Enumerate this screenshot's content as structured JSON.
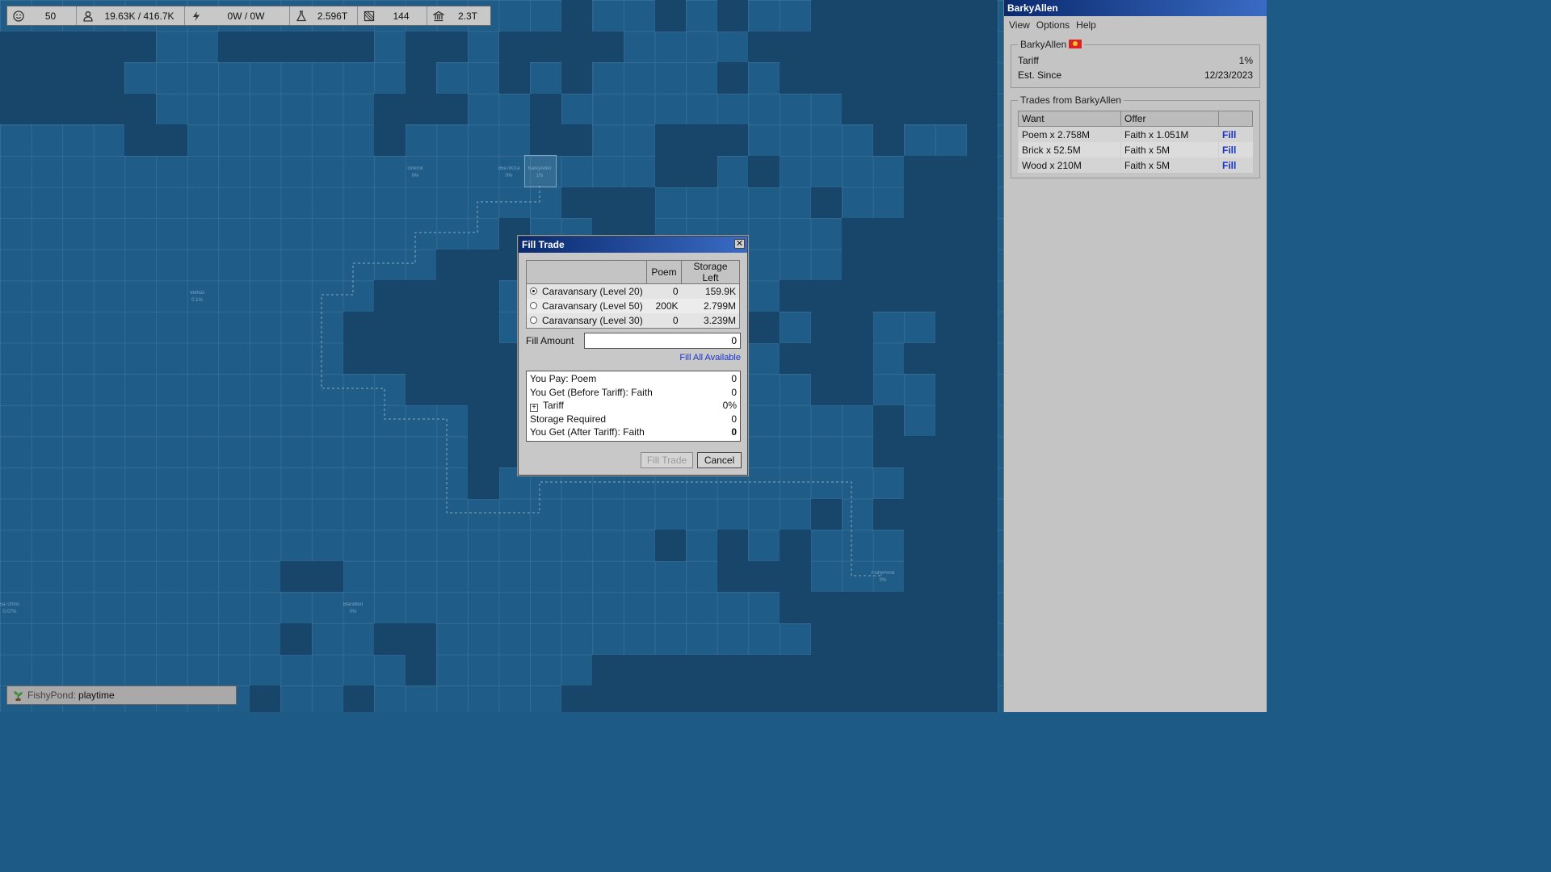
{
  "status_bar": {
    "happiness": "50",
    "population": "19.63K / 416.7K",
    "power": "0W / 0W",
    "research": "2.596T",
    "land": "144",
    "treasury": "2.3T"
  },
  "map": {
    "city_labels": [
      {
        "name": "Gnkrnk",
        "tariff": "0%"
      },
      {
        "name": "d5e7801a",
        "tariff": "0%"
      },
      {
        "name": "BarkyAllen",
        "tariff": "1%"
      },
      {
        "name": "Vethos",
        "tariff": "0.1%"
      },
      {
        "name": "FishyPond",
        "tariff": "0%"
      },
      {
        "name": "5a72f00c",
        "tariff": "0.07%"
      },
      {
        "name": "BlandBot",
        "tariff": "0%"
      }
    ]
  },
  "bottom_bar": {
    "user": "FishyPond",
    "separator": ":",
    "message": "playtime"
  },
  "panel": {
    "title": "BarkyAllen",
    "menu": [
      "View",
      "Options",
      "Help"
    ],
    "city_name": "BarkyAllen",
    "tariff_label": "Tariff",
    "tariff_value": "1%",
    "est_label": "Est. Since",
    "est_value": "12/23/2023",
    "trades_title": "Trades from BarkyAllen",
    "trades_headers": [
      "Want",
      "Offer",
      ""
    ],
    "trades": [
      {
        "want": "Poem x 2.758M",
        "offer": "Faith x 1.051M",
        "action": "Fill"
      },
      {
        "want": "Brick x 52.5M",
        "offer": "Faith x 5M",
        "action": "Fill"
      },
      {
        "want": "Wood x 210M",
        "offer": "Faith x 5M",
        "action": "Fill"
      }
    ]
  },
  "dialog": {
    "title": "Fill Trade",
    "close_glyph": "✕",
    "headers": [
      "",
      "Poem",
      "Storage Left"
    ],
    "stores": [
      {
        "name": "Caravansary (Level 20)",
        "poem": "0",
        "storage": "159.9K",
        "selected": true
      },
      {
        "name": "Caravansary (Level 50)",
        "poem": "200K",
        "storage": "2.799M",
        "selected": false
      },
      {
        "name": "Caravansary (Level 30)",
        "poem": "0",
        "storage": "3.239M",
        "selected": false
      }
    ],
    "fill_amount_label": "Fill Amount",
    "fill_amount_value": "0",
    "fill_all_label": "Fill All Available",
    "summary": {
      "pay_label": "You Pay: Poem",
      "pay_value": "0",
      "get_before_label": "You Get (Before Tariff): Faith",
      "get_before_value": "0",
      "tariff_label": "Tariff",
      "tariff_value": "0%",
      "storage_label": "Storage Required",
      "storage_value": "0",
      "get_after_label": "You Get (After Tariff): Faith",
      "get_after_value": "0"
    },
    "fill_button": "Fill Trade",
    "cancel_button": "Cancel"
  },
  "colors": {
    "map_water": "#1f5c87",
    "map_dark_tile": "#18456a",
    "title_gradient_start": "#0a2a6e",
    "title_gradient_end": "#3a6bc4",
    "link_blue": "#1a33c8"
  },
  "icons": [
    "smiley-icon",
    "person-icon",
    "lightning-icon",
    "flask-icon",
    "land-icon",
    "bank-icon",
    "plant-icon"
  ]
}
